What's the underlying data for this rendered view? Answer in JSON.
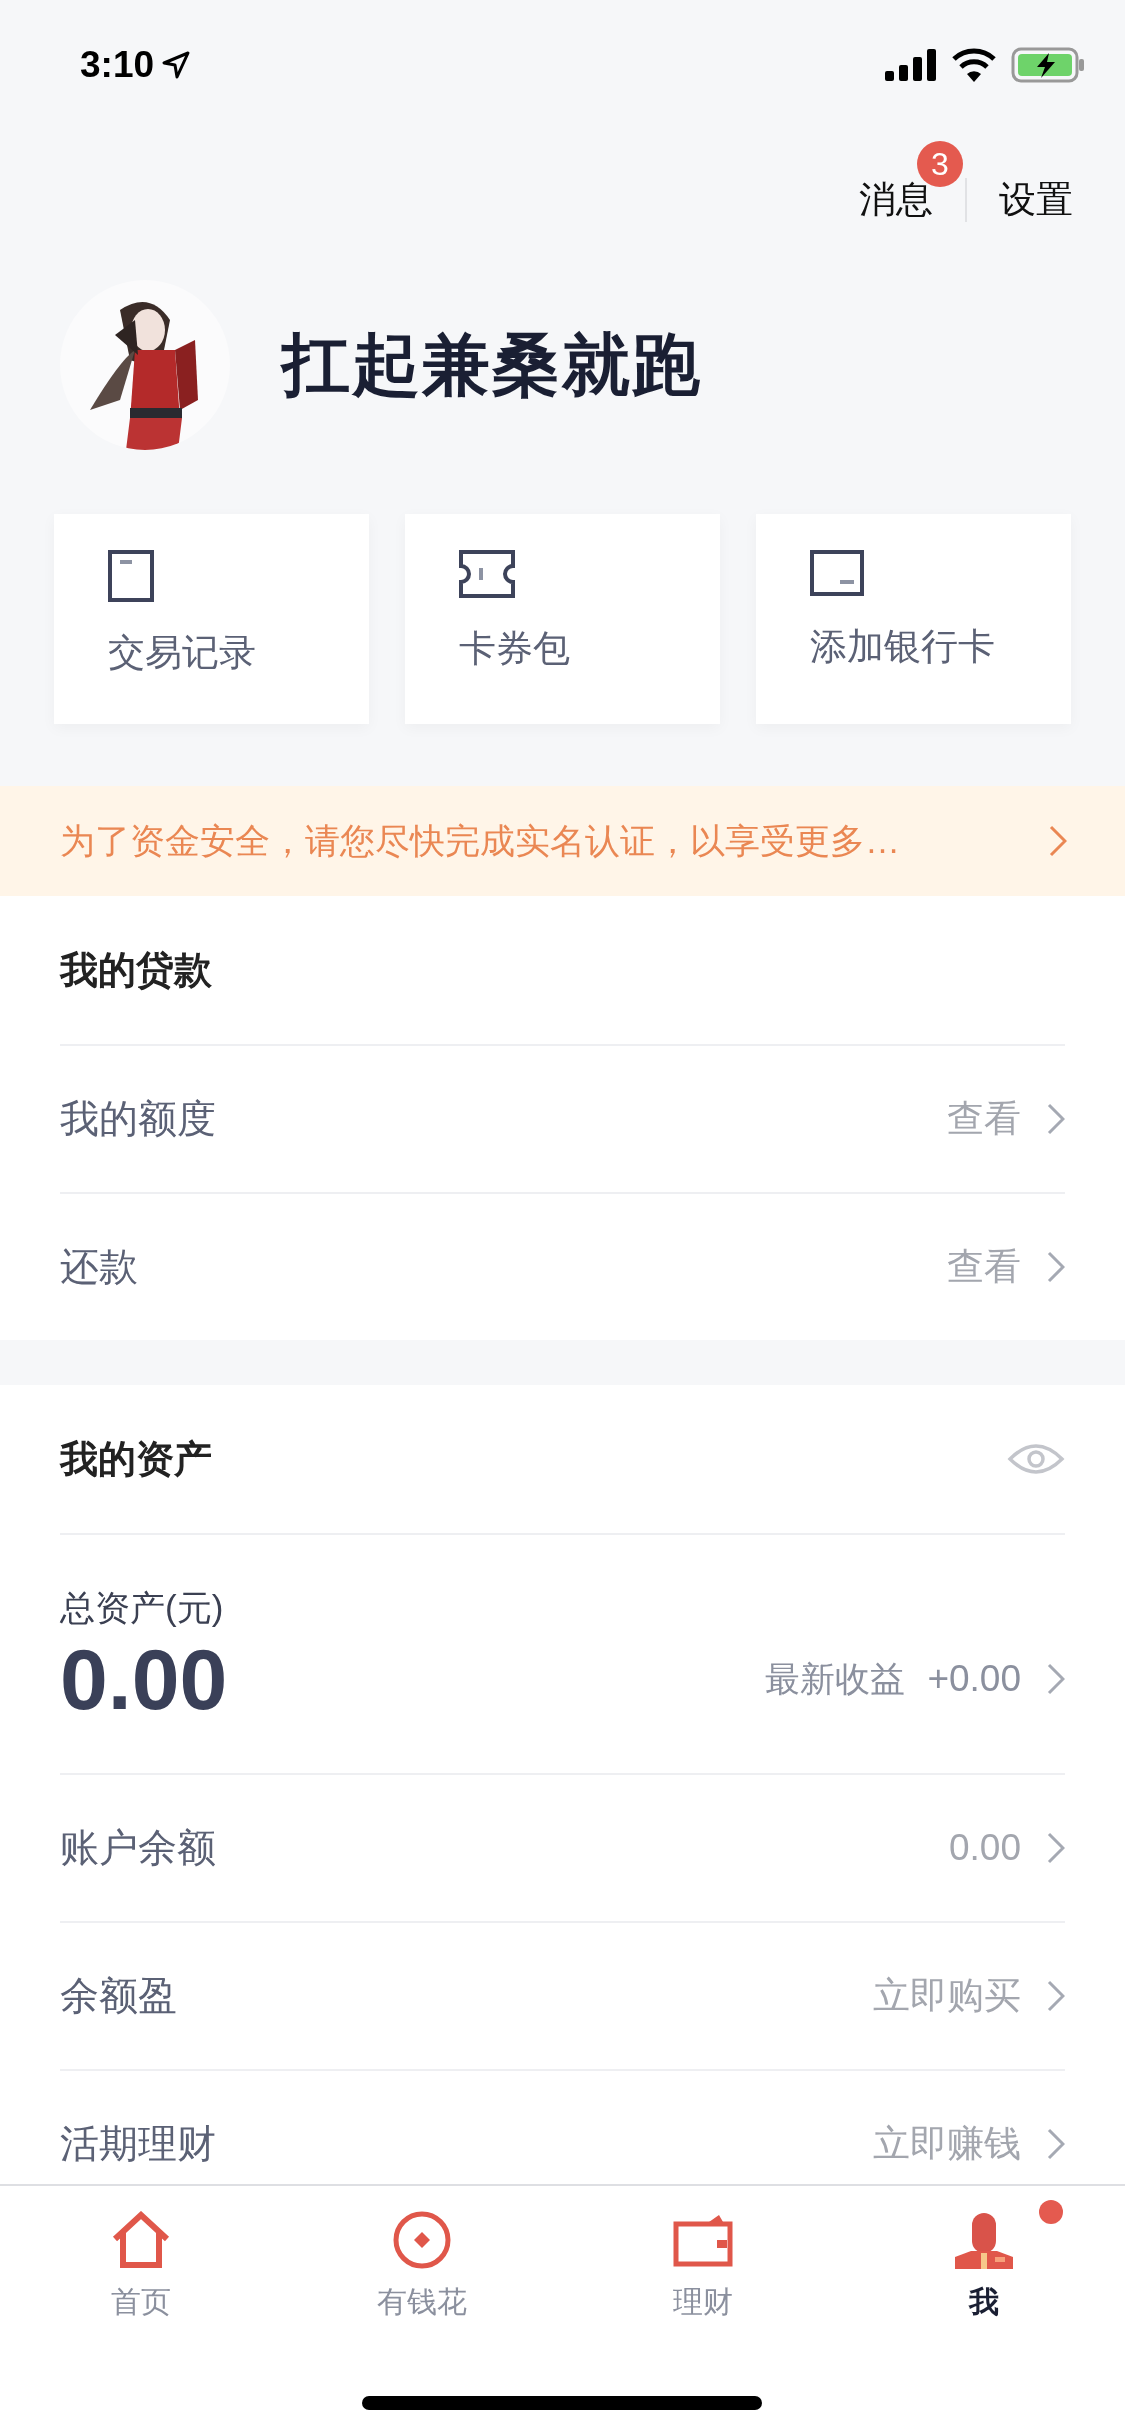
{
  "status_bar": {
    "time": "3:10"
  },
  "header": {
    "links": [
      {
        "label": "消息",
        "badge": "3"
      },
      {
        "label": "设置"
      }
    ],
    "username": "扛起兼桑就跑"
  },
  "shortcuts": [
    {
      "label": "交易记录"
    },
    {
      "label": "卡券包"
    },
    {
      "label": "添加银行卡"
    }
  ],
  "notice": {
    "text": "为了资金安全，请您尽快完成实名认证，以享受更多…"
  },
  "loans": {
    "title": "我的贷款",
    "rows": [
      {
        "label": "我的额度",
        "value": "查看"
      },
      {
        "label": "还款",
        "value": "查看"
      }
    ]
  },
  "assets": {
    "title": "我的资产",
    "total_label": "总资产(元)",
    "total": "0.00",
    "earnings_label": "最新收益",
    "earnings_value": "+0.00",
    "rows": [
      {
        "label": "账户余额",
        "value": "0.00"
      },
      {
        "label": "余额盈",
        "value": "立即购买"
      },
      {
        "label": "活期理财",
        "value": "立即赚钱"
      }
    ]
  },
  "tab_bar": {
    "tabs": [
      {
        "label": "首页",
        "selected": false,
        "dot": false
      },
      {
        "label": "有钱花",
        "selected": false,
        "dot": false
      },
      {
        "label": "理财",
        "selected": false,
        "dot": false
      },
      {
        "label": "我",
        "selected": true,
        "dot": true
      }
    ]
  }
}
